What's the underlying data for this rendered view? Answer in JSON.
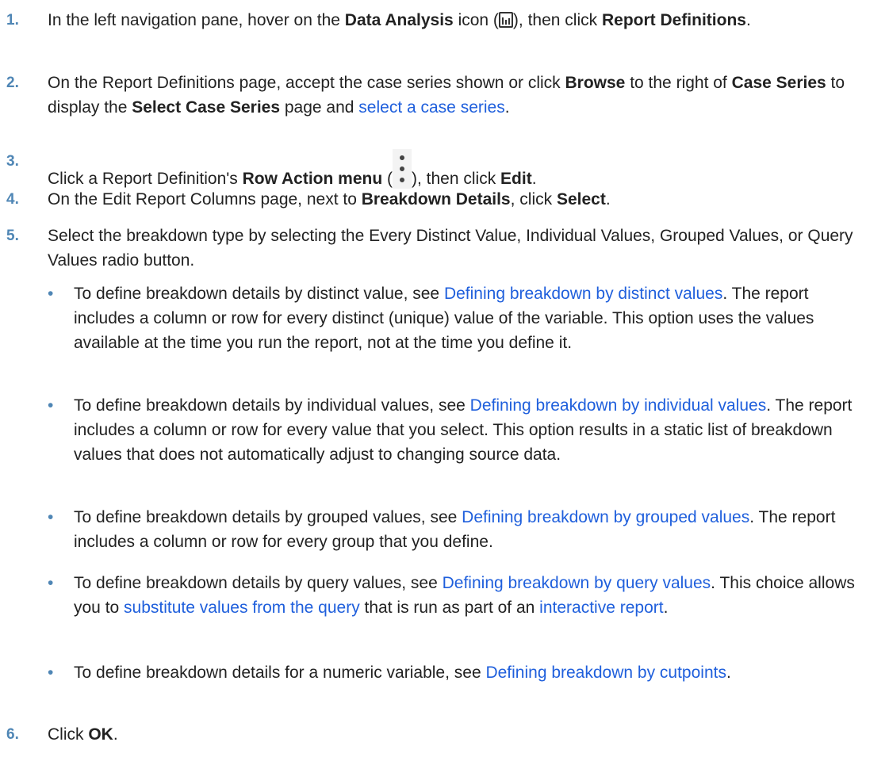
{
  "steps": [
    {
      "num": "1.",
      "pre": "In the left navigation pane, hover on the ",
      "b1": "Data Analysis",
      "mid": " icon (",
      "icon": "data-analysis-icon",
      "post": "), then click ",
      "b2": "Report Definitions",
      "end": "."
    },
    {
      "num": "2.",
      "pre": "On the Report Definitions page, accept the case series shown or click ",
      "b1": "Browse",
      "mid1": " to the right of ",
      "b2": "Case Series",
      "mid2": " to display the ",
      "b3": "Select Case Series",
      "mid3": " page and ",
      "link": "select a case series",
      "end": "."
    },
    {
      "num": "3.",
      "pre": "Click a Report Definition's ",
      "b1": "Row Action menu",
      "mid": " (",
      "icon": "kebab-menu-icon",
      "post": "), then click ",
      "b2": "Edit",
      "end": "."
    },
    {
      "num": "4.",
      "pre": "On the Edit Report Columns page, next to ",
      "b1": "Breakdown Details",
      "mid": ", click ",
      "b2": "Select",
      "end": "."
    },
    {
      "num": "5.",
      "text": "Select the breakdown type by selecting the Every Distinct Value, Individual Values, Grouped Values, or Query Values radio button.",
      "bullets": [
        {
          "pre": "To define breakdown details by distinct value, see ",
          "link": "Defining breakdown by distinct values",
          "post": ". The report includes a column or row for every distinct (unique) value of the variable. This option uses the values available at the time you run the report, not at the time you define it."
        },
        {
          "pre": "To define breakdown details by individual values, see ",
          "link": "Defining breakdown by individual values",
          "post": ". The report includes a column or row for every value that you select. This option results in a static list of breakdown values that does not automatically adjust to changing source data."
        },
        {
          "pre": "To define breakdown details by grouped values, see ",
          "link": "Defining breakdown by grouped values",
          "post": ". The report includes a column or row for every group that you define."
        },
        {
          "pre": "To define breakdown details by query values, see ",
          "link": "Defining breakdown by query values",
          "mid": ". This choice allows you to ",
          "link2": "substitute values from the query",
          "mid2": " that is run as part of an ",
          "link3": "interactive report",
          "post": "."
        },
        {
          "pre": "To define breakdown details for a numeric variable, see ",
          "link": "Defining breakdown by cutpoints",
          "post": "."
        }
      ]
    },
    {
      "num": "6.",
      "pre": "Click ",
      "b1": "OK",
      "end": "."
    }
  ],
  "bullet_glyph": "•",
  "colors": {
    "text": "#222222",
    "link": "#1f5fdc",
    "number": "#4f86b5"
  }
}
